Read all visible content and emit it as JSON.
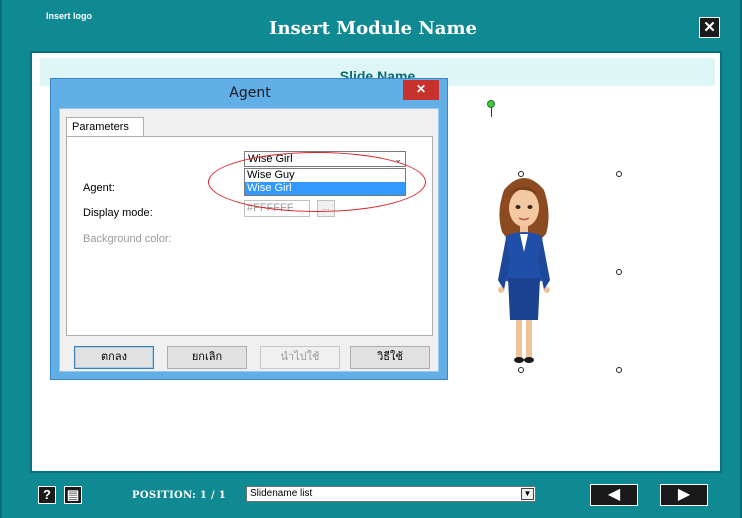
{
  "player": {
    "logo_text": "Insert logo",
    "module_title": "Insert Module Name",
    "close_symbol": "✕",
    "slide_name": "Slide Name",
    "help_symbol": "?",
    "notes_symbol": "▤",
    "position_label": "POSITION: 1 / 1",
    "slidelist_value": "Slidename list",
    "slidelist_arrow": "▼",
    "prev_symbol": "◀",
    "next_symbol": "▶"
  },
  "dialog": {
    "title": "Agent",
    "close_symbol": "✕",
    "tab_label": "Parameters",
    "agent_label": "Agent:",
    "agent_value": "Wise Girl",
    "agent_chevron": "⌄",
    "agent_options": [
      "Wise Guy",
      "Wise Girl"
    ],
    "agent_selected_index": 1,
    "display_mode_label": "Display mode:",
    "bg_color_label": "Background color:",
    "bg_color_value": "#FFFFFF",
    "color_picker_label": "...",
    "buttons": {
      "ok": "ตกลง",
      "cancel": "ยกเลิก",
      "apply": "นำไปใช้",
      "help": "วิธีใช้"
    }
  },
  "colors": {
    "frame": "#0f8a93",
    "dialog_frame": "#62aee6",
    "highlight": "#d8232a",
    "selection": "#3399ff"
  }
}
